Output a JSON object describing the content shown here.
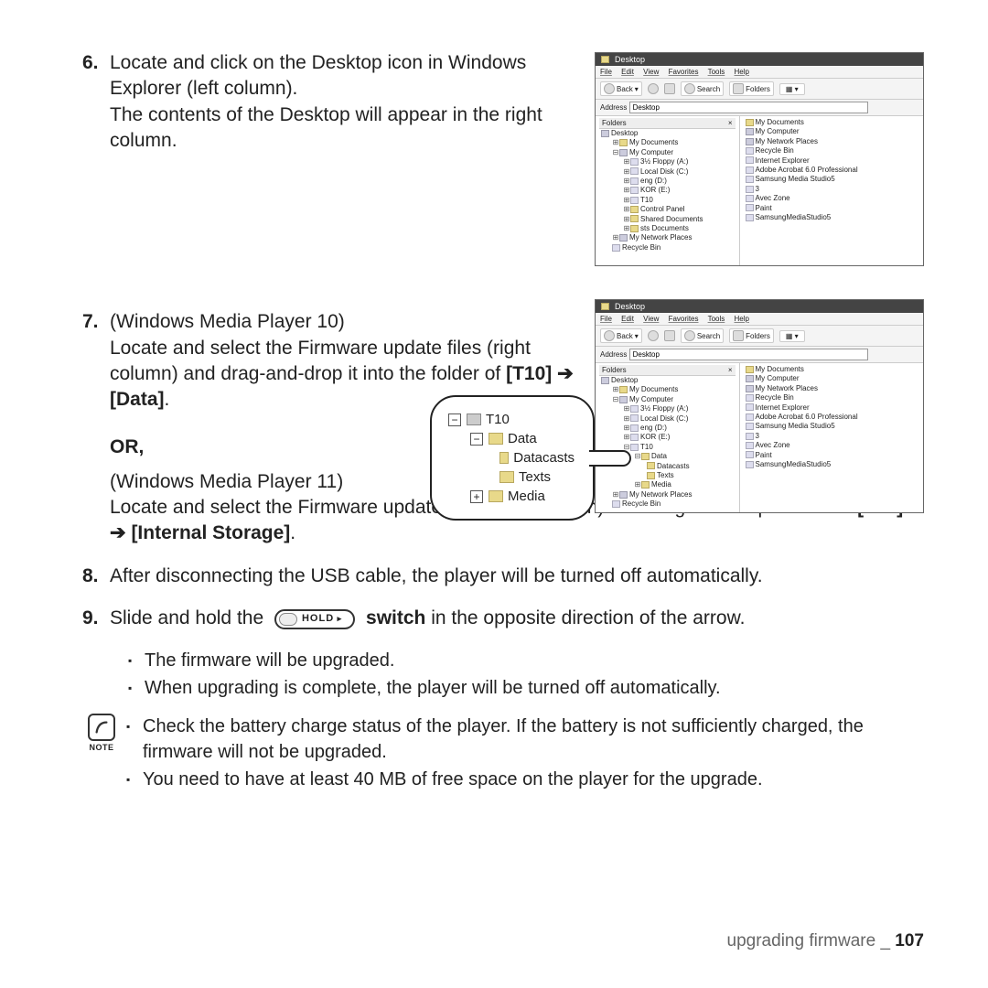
{
  "steps": {
    "s6_num": "6.",
    "s6_line1": "Locate and click on the Desktop icon in Windows Explorer (left column).",
    "s6_line2": "The contents of the Desktop will appear in the right column.",
    "s7_num": "7.",
    "s7_line1": "(Windows Media Player 10)",
    "s7_line2a": "Locate and select the Firmware update files (right column) and drag-and-drop it into the folder of ",
    "s7_path1_a": "[T10]",
    "s7_arrow": " ➔ ",
    "s7_path1_b": "[Data]",
    "s7_dot": ".",
    "or": "OR,",
    "s7b_line1": "(Windows Media Player 11)",
    "s7b_line2a": "Locate and select the Firmware update files (right column) and drag-and-drop it into the ",
    "s7b_path_a": "[T10]",
    "s7b_path_b": "[Internal Storage]",
    "s8_num": "8.",
    "s8_text": "After disconnecting the USB cable, the player will be turned off automatically.",
    "s9_num": "9.",
    "s9_a": "Slide and hold the ",
    "s9_hold": "HOLD",
    "s9_b": " switch",
    "s9_c": " in the opposite direction of the arrow."
  },
  "bullets": {
    "b1": "The firmware will be upgraded.",
    "b2": "When upgrading is complete, the player will be turned off automatically.",
    "n1": "Check the battery charge status of the player. If the battery is not sufficiently charged, the firmware will not be upgraded.",
    "n2": "You need to have at least 40 MB of free space on the player for the upgrade."
  },
  "note_label": "NOTE",
  "footer": {
    "section": "upgrading firmware",
    "sep": " _ ",
    "page": "107"
  },
  "win": {
    "title": "Desktop",
    "menu": [
      "File",
      "Edit",
      "View",
      "Favorites",
      "Tools",
      "Help"
    ],
    "back": "Back",
    "search": "Search",
    "folders": "Folders",
    "addr_label": "Address",
    "addr_val": "Desktop",
    "folders_head": "Folders",
    "close_x": "×"
  },
  "tree1": [
    "Desktop",
    "My Documents",
    "My Computer",
    "3½ Floppy (A:)",
    "Local Disk (C:)",
    "eng (D:)",
    "KOR (E:)",
    "T10",
    "Control Panel",
    "Shared Documents",
    "sts Documents",
    "My Network Places",
    "Recycle Bin"
  ],
  "contents1": [
    "My Documents",
    "My Computer",
    "My Network Places",
    "Recycle Bin",
    "Internet Explorer",
    "Adobe Acrobat 6.0 Professional",
    "Samsung Media Studio5",
    "3",
    "Avec Zone",
    "Paint",
    "SamsungMediaStudio5"
  ],
  "tree2": [
    "Desktop",
    "My Documents",
    "My Computer",
    "3½ Floppy (A:)",
    "Local Disk (C:)",
    "eng (D:)",
    "KOR (E:)",
    "T10",
    "Data",
    "Datacasts",
    "Texts",
    "Media",
    "My Network Places",
    "Recycle Bin"
  ],
  "contents2": [
    "My Documents",
    "My Computer",
    "My Network Places",
    "Recycle Bin",
    "Internet Explorer",
    "Adobe Acrobat 6.0 Professional",
    "Samsung Media Studio5",
    "3",
    "Avec Zone",
    "Paint",
    "SamsungMediaStudio5"
  ],
  "bubble": {
    "t10": "T10",
    "data": "Data",
    "datacasts": "Datacasts",
    "texts": "Texts",
    "media": "Media"
  }
}
